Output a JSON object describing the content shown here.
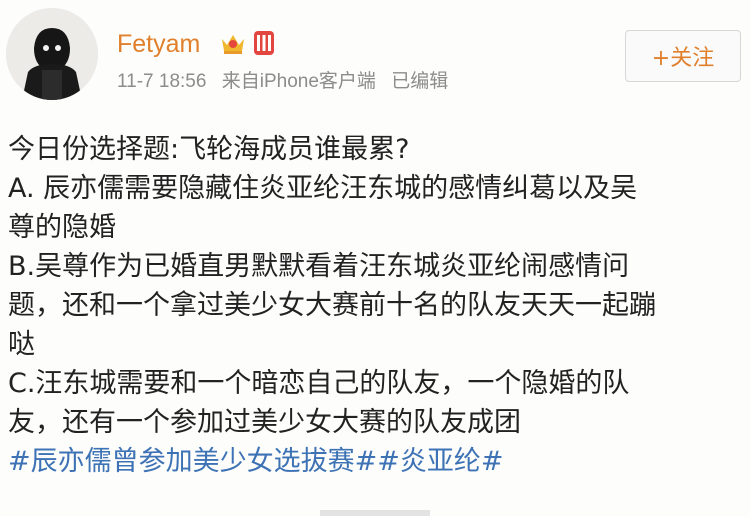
{
  "post": {
    "username": "Fetyam",
    "icons": [
      "crown-badge-icon",
      "vip-member-icon"
    ],
    "time": "11-7 18:56",
    "source": "来自iPhone客户端",
    "edited": "已编辑",
    "follow_label": "+关注",
    "lines": [
      "今日份选择题:飞轮海成员谁最累?",
      "A. 辰亦儒需要隐藏住炎亚纶汪东城的感情纠葛以及吴",
      "尊的隐婚",
      "B.吴尊作为已婚直男默默看着汪东城炎亚纶闹感情问",
      "题，还和一个拿过美少女大赛前十名的队友天天一起蹦",
      "哒",
      "C.汪东城需要和一个暗恋自己的队友，一个隐婚的队",
      "友，还有一个参加过美少女大赛的队友成团"
    ],
    "topics": "#辰亦儒曾参加美少女选拔赛##炎亚纶#"
  },
  "colors": {
    "username": "#e0802c",
    "meta": "#8c8c8c",
    "topic": "#3d72b4",
    "text": "#222222"
  }
}
